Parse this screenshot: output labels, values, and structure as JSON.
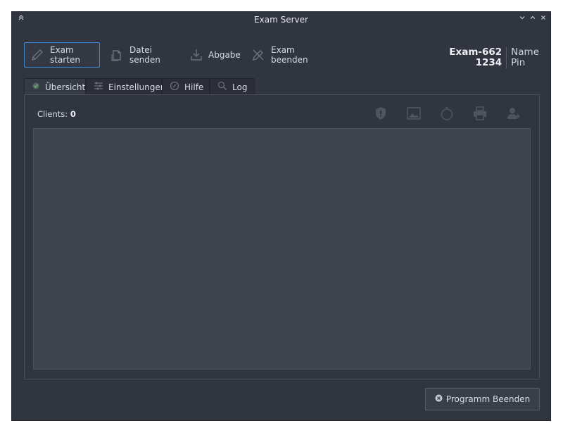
{
  "window": {
    "title": "Exam Server"
  },
  "toolbar": {
    "start_label": "Exam starten",
    "send_label": "Datei senden",
    "submit_label": "Abgabe",
    "end_label": "Exam beenden"
  },
  "exam": {
    "name_value": "Exam-662",
    "pin_value": "1234",
    "name_label": "Name",
    "pin_label": "Pin"
  },
  "tabs": [
    {
      "label": "Übersicht"
    },
    {
      "label": "Einstellungen"
    },
    {
      "label": "Hilfe"
    },
    {
      "label": "Log"
    }
  ],
  "overview": {
    "clients_label": "Clients:",
    "clients_count": "0"
  },
  "footer": {
    "quit_label": "Programm Beenden"
  },
  "icons": [
    "pencil-icon",
    "send-file-icon",
    "download-icon",
    "pen-off-icon",
    "shield-icon",
    "image-icon",
    "timer-icon",
    "printer-icon",
    "add-user-icon",
    "close-circle-icon"
  ],
  "colors": {
    "accent": "#3d8ad2",
    "window_bg": "#31353f",
    "status_green": "#4cbf4c"
  }
}
